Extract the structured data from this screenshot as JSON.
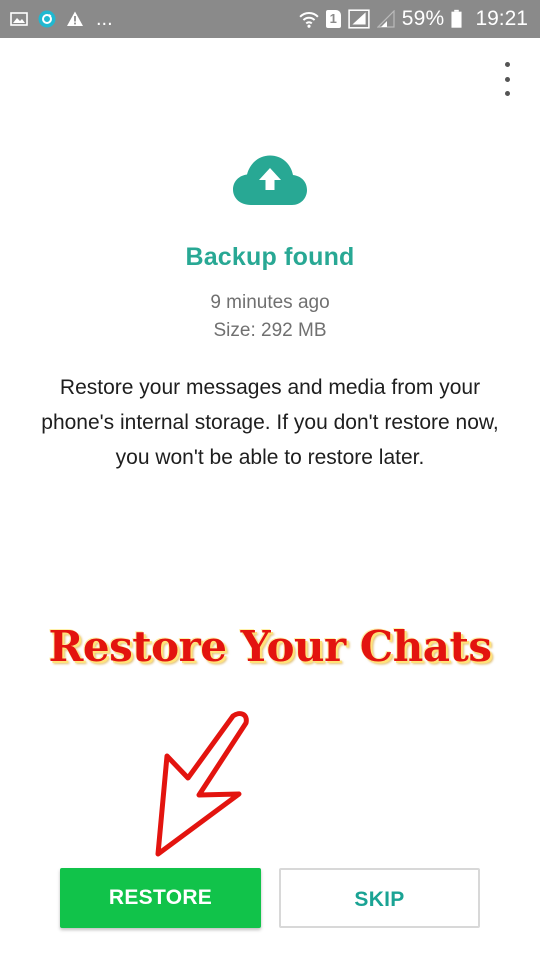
{
  "status_bar": {
    "battery_percent": "59%",
    "time": "19:21",
    "overflow_dots": "...",
    "sim_label": "1",
    "icons": [
      "image-icon",
      "sync-icon",
      "warning-icon",
      "wifi-icon",
      "sim-icon",
      "signal-icon",
      "battery-icon"
    ]
  },
  "backup": {
    "title": "Backup found",
    "time_ago": "9 minutes ago",
    "size": "Size: 292 MB",
    "description": "Restore your messages and media from your phone's internal storage. If you don't restore now, you won't be able to restore later."
  },
  "overlay": {
    "caption": "Restore Your Chats"
  },
  "actions": {
    "restore_label": "RESTORE",
    "skip_label": "SKIP"
  },
  "colors": {
    "accent_teal": "#28a894",
    "restore_green": "#11c34a",
    "status_bar": "#8a8a8a",
    "caption_red": "#e3140f"
  }
}
